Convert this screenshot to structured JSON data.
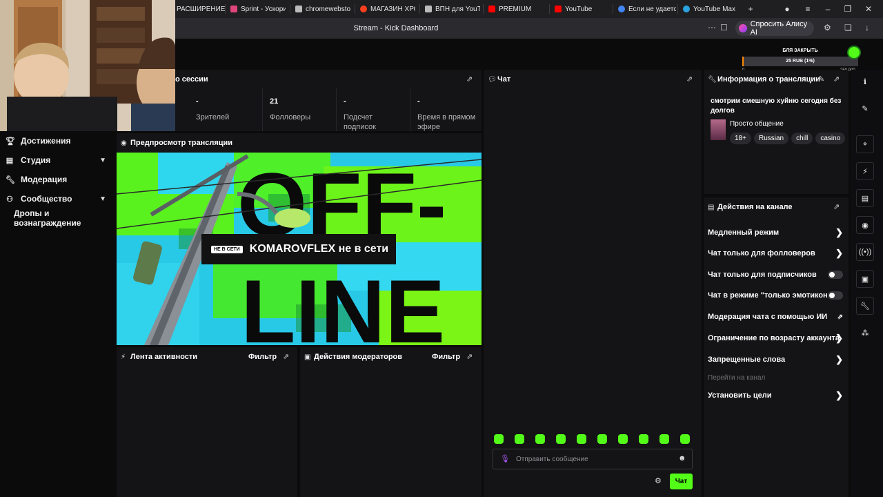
{
  "browser": {
    "tabs": [
      {
        "label": "РАСШИРЕНИЕ",
        "icon": "puzzle-icon",
        "color": "#ffffff"
      },
      {
        "label": "Sprint - Ускори",
        "icon": "sprint-icon",
        "color": "#e0457b"
      },
      {
        "label": "chromewebstor",
        "icon": "document-icon",
        "color": "#bbbbbb"
      },
      {
        "label": "МАГАЗИН ХРО",
        "icon": "yandex-icon",
        "color": "#fc3f1d"
      },
      {
        "label": "ВПН для YouTu",
        "icon": "document-icon",
        "color": "#bbbbbb"
      },
      {
        "label": "PREMIUM",
        "icon": "youtube-icon",
        "color": "#ff0000"
      },
      {
        "label": "YouTube",
        "icon": "youtube-icon",
        "color": "#ff0000"
      },
      {
        "label": "Если не удаетс",
        "icon": "google-icon",
        "color": "#4285f4"
      },
      {
        "label": "YouTube Max -",
        "icon": "telegram-icon",
        "color": "#2aa3df"
      }
    ],
    "page_title": "Stream - Kick Dashboard",
    "alice_label": "Спросить Алису AI"
  },
  "goal": {
    "label": "БЛЯ ЗАКРЫТЬ",
    "progress_text": "25 RUB (1%)",
    "min": "0",
    "max": "250 000",
    "progress_fraction": 0.01,
    "accent": "#53fc18"
  },
  "sidebar": {
    "items": [
      {
        "label": "Достижения",
        "icon": "trophy-icon",
        "expandable": false
      },
      {
        "label": "Студия",
        "icon": "studio-icon",
        "expandable": true
      },
      {
        "label": "Модерация",
        "icon": "wrench-icon",
        "expandable": false
      },
      {
        "label": "Сообщество",
        "icon": "community-icon",
        "expandable": true
      },
      {
        "label": "Дропы и вознаграждение",
        "icon": "",
        "expandable": false
      }
    ]
  },
  "session": {
    "title_partial": "о сессии",
    "stats": [
      {
        "value": "-",
        "label": "Зрителей"
      },
      {
        "value": "21",
        "label": "Фолловеры"
      },
      {
        "value": "-",
        "label": "Подсчет подписок"
      },
      {
        "value": "-",
        "label": "Время в прямом эфире"
      }
    ]
  },
  "preview": {
    "title": "Предпросмотр трансляции",
    "offline_tag": "НЕ В СЕТИ",
    "offline_text": "KOMAROVFLEX не в сети",
    "big_text_line1": "OFF-",
    "big_text_line2": "LINE"
  },
  "activity": {
    "title": "Лента активности",
    "filter": "Фильтр"
  },
  "mod_actions": {
    "title": "Действия модераторов",
    "filter": "Фильтр"
  },
  "chat": {
    "title": "Чат",
    "placeholder": "Отправить сообщение",
    "send_label": "Чат",
    "emote_count": 10
  },
  "stream_info": {
    "title": "Информация о трансляции",
    "stream_title": "смотрим смешную хуйню сегодня без долгов",
    "category": "Просто общение",
    "tags": [
      "18+",
      "Russian",
      "chill",
      "casino"
    ]
  },
  "channel_actions": {
    "title": "Действия на канале",
    "items": [
      {
        "label": "Медленный режим",
        "control": "arrow"
      },
      {
        "label": "Чат только для фолловеров",
        "control": "arrow"
      },
      {
        "label": "Чат только для подписчиков",
        "control": "toggle"
      },
      {
        "label": "Чат в режиме \"только эмотиконы\"",
        "control": "toggle"
      },
      {
        "label": "Модерация чата с помощью ИИ",
        "control": "external"
      },
      {
        "label": "Ограничение по возрасту аккаунта",
        "control": "arrow"
      },
      {
        "label": "Запрещенные слова",
        "control": "arrow"
      },
      {
        "label": "Перейти на канал",
        "control": "none"
      },
      {
        "label": "Установить цели",
        "control": "arrow"
      }
    ]
  },
  "rail": {
    "icons": [
      "info-icon",
      "pencil-icon",
      "scan-icon",
      "lightning-icon",
      "note-icon",
      "chat-bubble-icon",
      "broadcast-icon",
      "layout-icon",
      "wrench-icon",
      "share-icon"
    ]
  }
}
